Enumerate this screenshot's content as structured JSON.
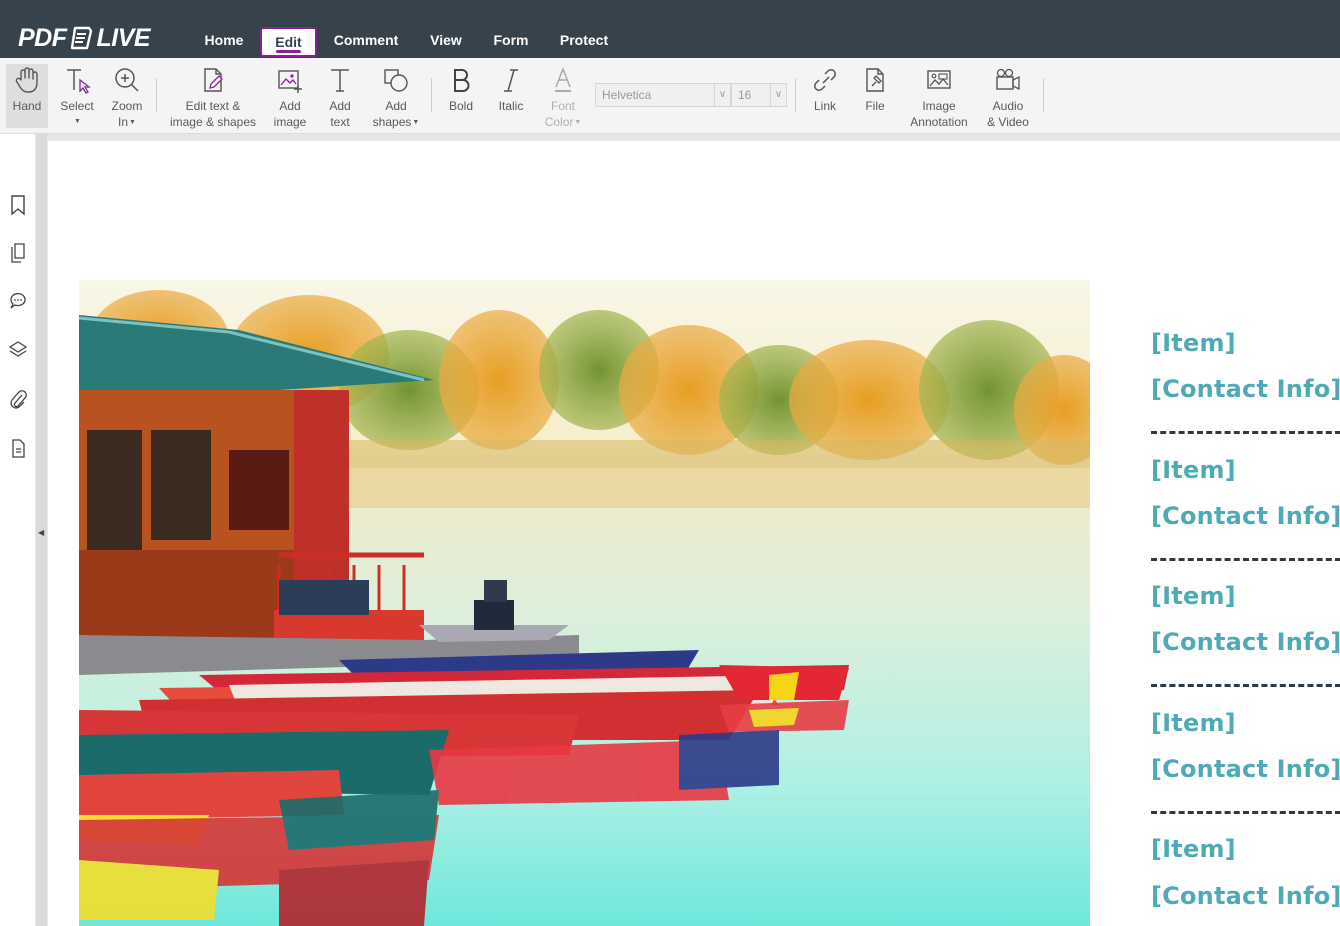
{
  "app": {
    "logo_left": "PDF",
    "logo_right": "LIVE"
  },
  "menu": {
    "home": "Home",
    "edit": "Edit",
    "comment": "Comment",
    "view": "View",
    "form": "Form",
    "protect": "Protect"
  },
  "toolbar": {
    "hand": "Hand",
    "select_1": "Select",
    "zoom_1": "Zoom",
    "zoom_2": "In",
    "edit_text_1": "Edit text &",
    "edit_text_2": "image & shapes",
    "add_image_1": "Add",
    "add_image_2": "image",
    "add_text_1": "Add",
    "add_text_2": "text",
    "add_shapes_1": "Add",
    "add_shapes_2": "shapes",
    "bold": "Bold",
    "italic": "Italic",
    "font_color_1": "Font",
    "font_color_2": "Color",
    "font_family": "Helvetica",
    "font_size": "16",
    "link": "Link",
    "file": "File",
    "image_annotation_1": "Image",
    "image_annotation_2": "Annotation",
    "audio_video_1": "Audio",
    "audio_video_2": "& Video"
  },
  "sidebar_icons": [
    "bookmark-icon",
    "pages-icon",
    "comments-icon",
    "layers-icon",
    "attachment-icon",
    "form-fields-icon"
  ],
  "document": {
    "entries": [
      {
        "item": "[Item]",
        "contact": "[Contact Info]"
      },
      {
        "item": "[Item]",
        "contact": "[Contact Info]"
      },
      {
        "item": "[Item]",
        "contact": "[Contact Info]"
      },
      {
        "item": "[Item]",
        "contact": "[Contact Info]"
      },
      {
        "item": "[Item]",
        "contact": "[Contact Info]"
      }
    ]
  },
  "colors": {
    "topbar": "#37434c",
    "accent": "#8a1f9b",
    "item_text": "#4eabb6"
  }
}
